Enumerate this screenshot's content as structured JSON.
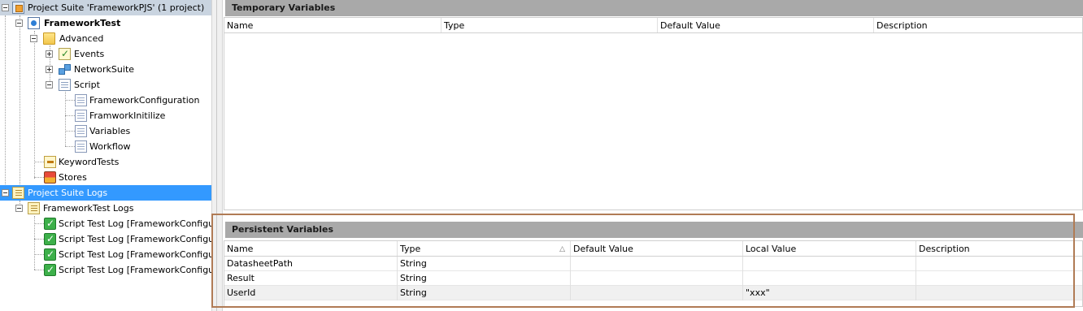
{
  "tree": {
    "project_suite": "Project Suite 'FrameworkPJS' (1 project)",
    "project": "FrameworkTest",
    "advanced": "Advanced",
    "events": "Events",
    "network_suite": "NetworkSuite",
    "script": "Script",
    "script_units": [
      "FrameworkConfiguration",
      "FramworkInitilize",
      "Variables",
      "Workflow"
    ],
    "keyword_tests": "KeywordTests",
    "stores": "Stores",
    "suite_logs": "Project Suite Logs",
    "project_logs": "FrameworkTest Logs",
    "log_items": [
      "Script Test Log [FrameworkConfiguration]",
      "Script Test Log [FrameworkConfiguration]",
      "Script Test Log [FrameworkConfiguration]",
      "Script Test Log [FrameworkConfiguration]"
    ]
  },
  "temporary": {
    "title": "Temporary Variables",
    "columns": [
      "Name",
      "Type",
      "Default Value",
      "Description"
    ]
  },
  "persistent": {
    "title": "Persistent Variables",
    "columns": [
      "Name",
      "Type",
      "Default Value",
      "Local Value",
      "Description"
    ],
    "rows": [
      [
        "DatasheetPath",
        "String",
        "",
        "",
        ""
      ],
      [
        "Result",
        "String",
        "",
        "",
        ""
      ],
      [
        "UserId",
        "String",
        "",
        "\"xxx\"",
        ""
      ]
    ],
    "sort_indicator": "△"
  },
  "colors": {
    "selection": "#3399ff",
    "header_bar": "#a9a9a9",
    "highlight_box": "#b07b55"
  }
}
